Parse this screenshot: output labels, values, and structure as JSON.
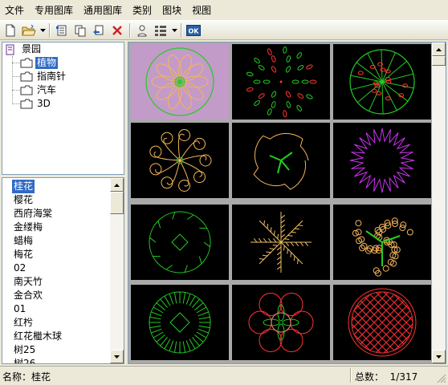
{
  "menu": [
    "文件",
    "专用图库",
    "通用图库",
    "类别",
    "图块",
    "视图"
  ],
  "toolbar": {
    "icons": [
      "new-icon",
      "open-folder-icon",
      "dropdown-arrow-icon",
      "block-insert-icon",
      "block-copy-icon",
      "block-export-icon",
      "delete-icon",
      "user-icon",
      "grid-view-icon",
      "dropdown-arrow-icon",
      "ok-icon"
    ],
    "ok_label": "OK"
  },
  "tree": {
    "root": "景园",
    "children": [
      {
        "label": "植物",
        "selected": true
      },
      {
        "label": "指南针",
        "selected": false
      },
      {
        "label": "汽车",
        "selected": false
      },
      {
        "label": "3D",
        "selected": false
      }
    ]
  },
  "list": {
    "items": [
      "桂花",
      "樱花",
      "西府海棠",
      "金缕梅",
      "蜡梅",
      "梅花",
      "02",
      "南天竹",
      "金合欢",
      "01",
      "红枍",
      "红花檵木球",
      "树25",
      "树26"
    ],
    "selected_index": 0
  },
  "gallery": {
    "thumbs": [
      {
        "name": "flower-rosette",
        "selected": true
      },
      {
        "name": "leaf-ring"
      },
      {
        "name": "spoke-tree"
      },
      {
        "name": "cloud-flower"
      },
      {
        "name": "irregular-canopy"
      },
      {
        "name": "spiky-burst"
      },
      {
        "name": "diamond-circle"
      },
      {
        "name": "fern-cluster"
      },
      {
        "name": "bubbly-tree"
      },
      {
        "name": "radial-hatch"
      },
      {
        "name": "red-flower"
      },
      {
        "name": "cross-hatch-circle"
      }
    ],
    "colors": {
      "green": "#22cc22",
      "orange": "#f5b45a",
      "red": "#ff3333",
      "purple": "#cc33ee",
      "yellow": "#f0c060",
      "pink": "#ff8888",
      "selected_bg": "#c39bc8",
      "thumb_bg": "#000000"
    }
  },
  "status": {
    "name_label": "名称：",
    "name_value": "桂花",
    "total_label": "总数：",
    "total_value": "1/317"
  }
}
